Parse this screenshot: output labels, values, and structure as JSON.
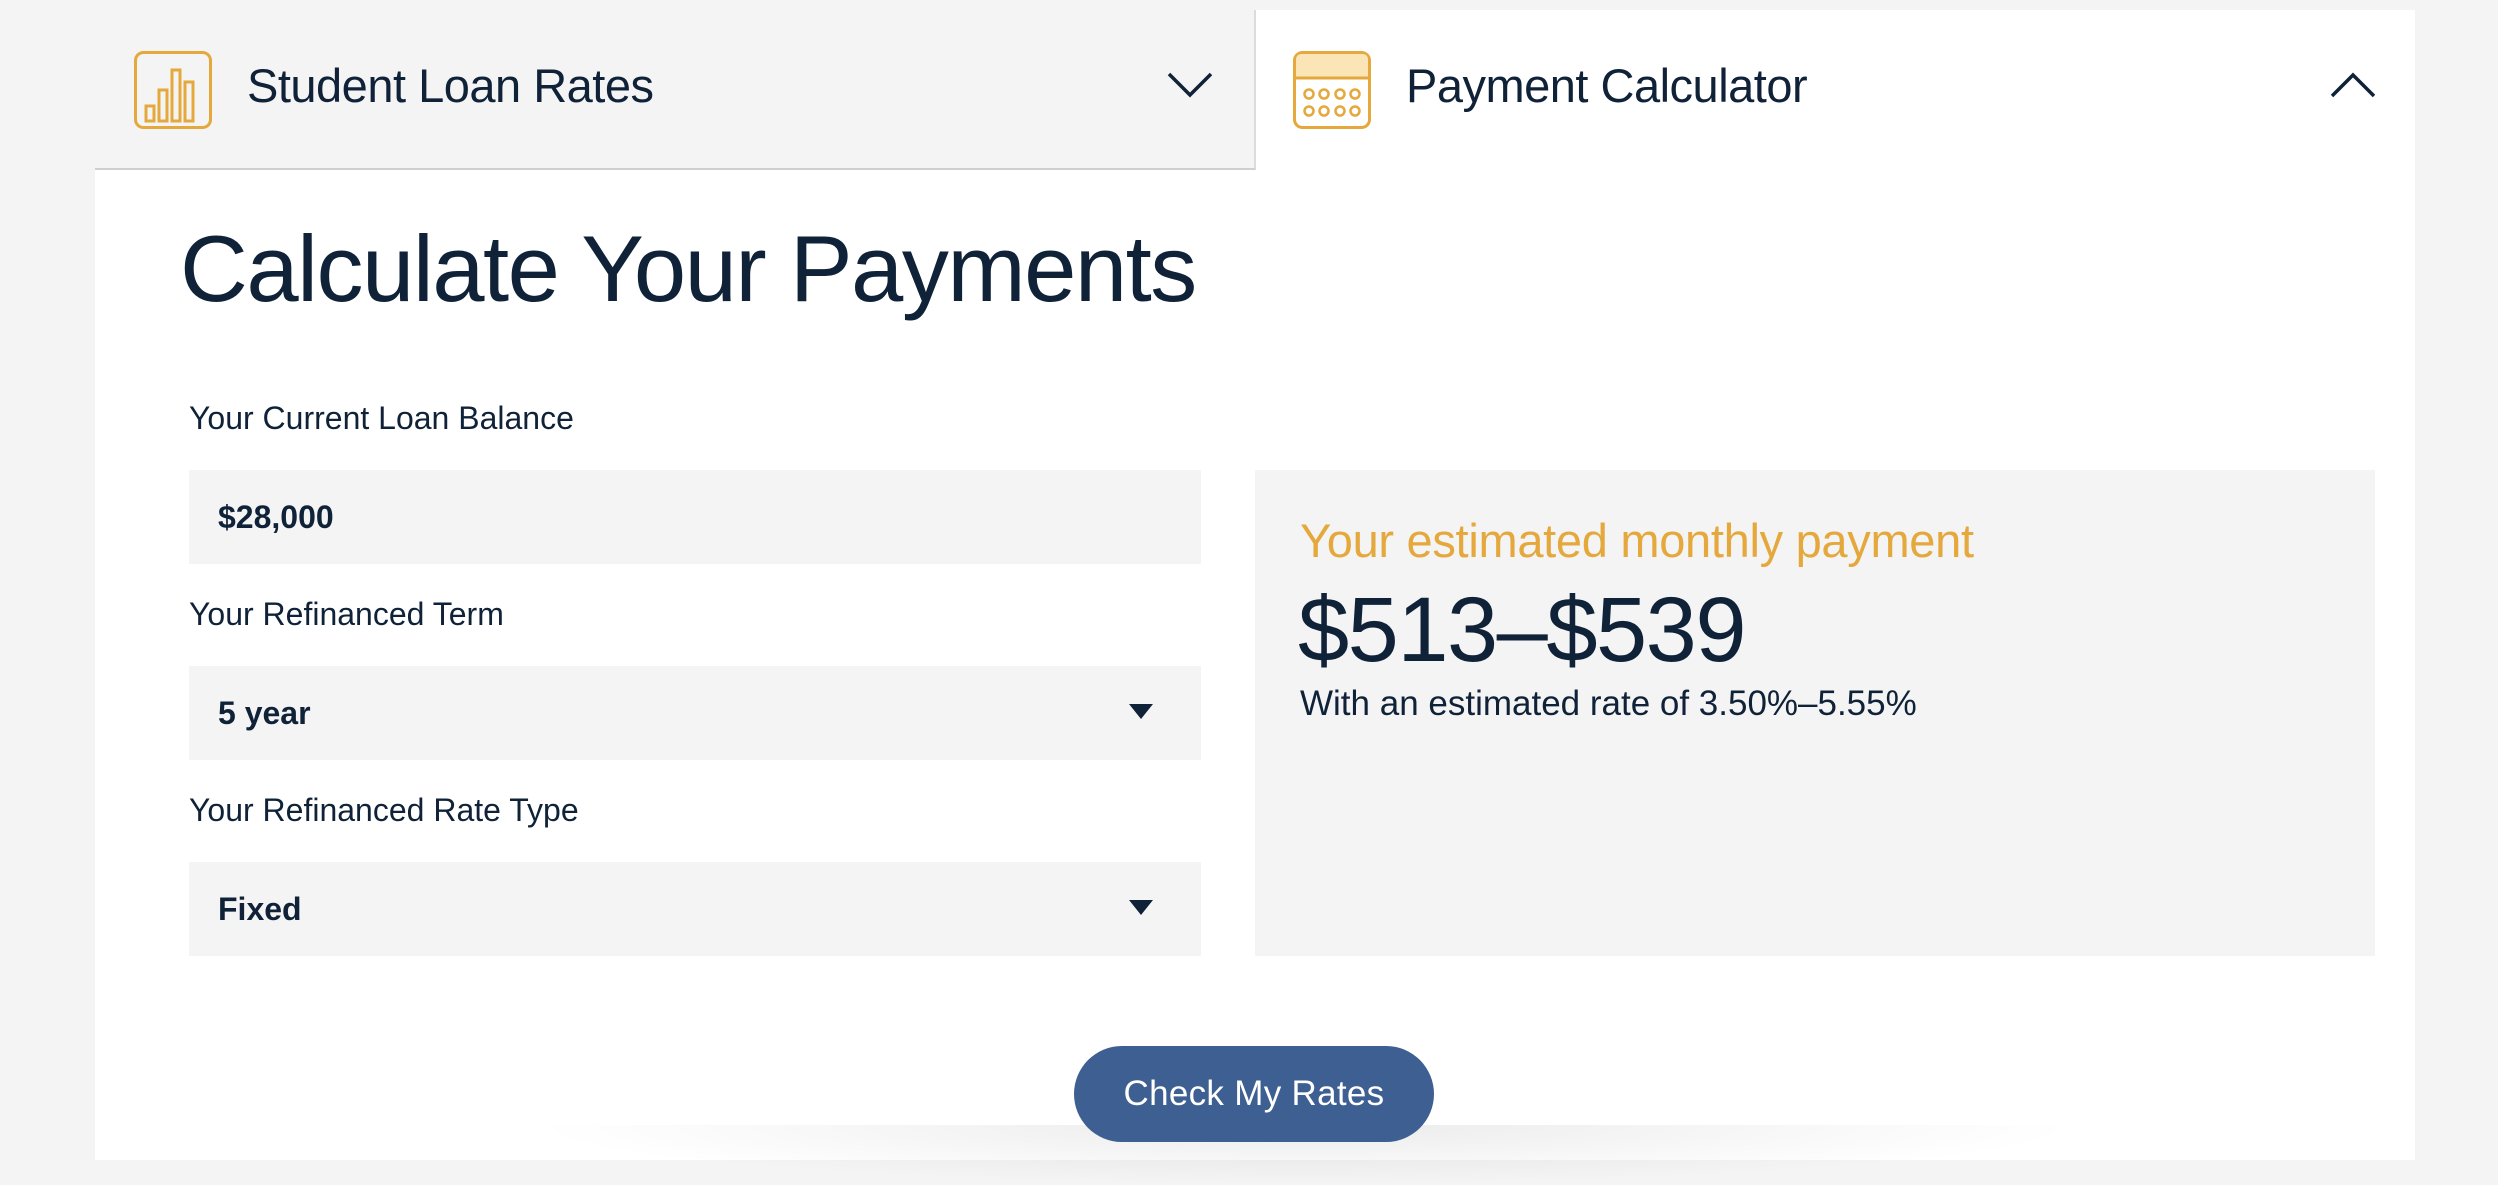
{
  "tabs": {
    "rates": {
      "label": "Student Loan Rates",
      "icon": "bar-chart-icon",
      "state": "collapsed"
    },
    "calculator": {
      "label": "Payment Calculator",
      "icon": "calculator-icon",
      "state": "expanded"
    }
  },
  "main": {
    "title": "Calculate Your Payments",
    "fields": {
      "balance": {
        "label": "Your Current Loan Balance",
        "value": "$28,000"
      },
      "term": {
        "label": "Your Refinanced Term",
        "value": "5 year"
      },
      "rate_type": {
        "label": "Your Refinanced Rate Type",
        "value": "Fixed"
      }
    },
    "estimate": {
      "heading": "Your estimated monthly payment",
      "amount": "$513–$539",
      "rate_text": "With an estimated rate of 3.50%–5.55%"
    },
    "cta": {
      "label": "Check My Rates"
    }
  },
  "colors": {
    "accent": "#e5a83c",
    "text": "#0f2238",
    "button": "#3d5f91",
    "panel": "#f4f4f4"
  }
}
